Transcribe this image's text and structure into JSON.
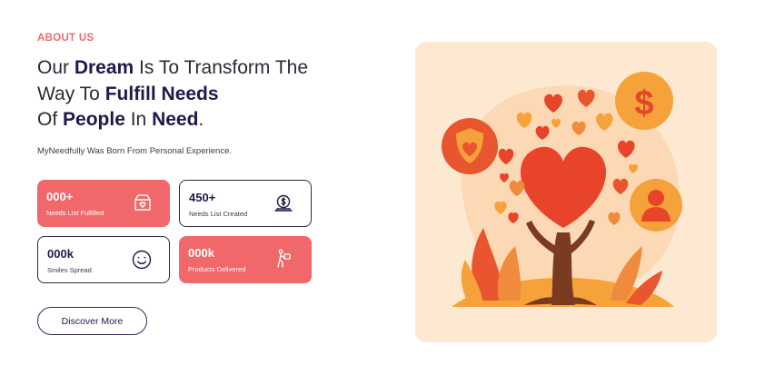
{
  "about": {
    "eyebrow": "ABOUT US",
    "headline_parts": {
      "p1": "Our ",
      "b1": "Dream",
      "p2": " Is To Transform The Way To ",
      "b2": "Fulfill Needs",
      "p3": " Of ",
      "b3": "People",
      "p4": " In ",
      "b4": "Need",
      "p5": "."
    },
    "subtitle": "MyNeedfully Was Born From Personal Experience."
  },
  "stats": [
    {
      "value": "000+",
      "label": "Needs List Fulfilled",
      "icon": "gift-box-heart-icon",
      "style": "filled"
    },
    {
      "value": "450+",
      "label": "Needs List Created",
      "icon": "dollar-coin-hand-icon",
      "style": "outline"
    },
    {
      "value": "000k",
      "label": "Smiles Spread",
      "icon": "smiley-face-icon",
      "style": "outline"
    },
    {
      "value": "000k",
      "label": "Products Delivered",
      "icon": "delivery-person-icon",
      "style": "filled"
    }
  ],
  "cta": {
    "label": "Discover More"
  },
  "colors": {
    "accent": "#f0686a",
    "navy": "#1e1a4b",
    "art_background": "#fde8d2",
    "heart_red": "#e8442a",
    "orange": "#f49a2c"
  },
  "illustration": {
    "name": "heart-tree-illustration"
  }
}
